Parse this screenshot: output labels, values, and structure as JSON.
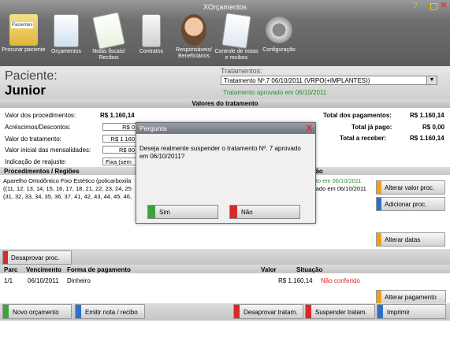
{
  "app": {
    "title": "XOrçamentos"
  },
  "toolbar": {
    "items": [
      {
        "label": "Procurar paciente"
      },
      {
        "label": "Orçamentos"
      },
      {
        "label": "Notas fiscais/ Recibos"
      },
      {
        "label": "Contratos"
      },
      {
        "label": "Responsáveis/ Beneficiários"
      },
      {
        "label": "Controle de notas e recibos"
      },
      {
        "label": "Configuração"
      }
    ],
    "badge": "Pacientes"
  },
  "patient": {
    "label": "Paciente:",
    "name": "Junior"
  },
  "treatments": {
    "label": "Tratamentos:",
    "selected": "Tratamento Nº.7 06/10/2011 (VRPO(+IMPLANTES))",
    "status": "Tratamento aprovado em 06/10/2011"
  },
  "values": {
    "header": "Valores do tratamento",
    "procedures_label": "Valor dos procedimentos:",
    "procedures_value": "R$ 1.160,14",
    "additions_label": "Acréscimos/Descontos:",
    "additions_value": "R$ 0",
    "treatment_label": "Valor do tratamento:",
    "treatment_value": "R$ 1.160",
    "initial_label": "Valor inicial das mensalidades:",
    "initial_value": "R$ 80",
    "readjust_label": "Indicação de reajuste:",
    "readjust_value": "Fixa (sem a",
    "total_payments_label": "Total dos pagamentos:",
    "total_payments_value": "R$ 1.160,14",
    "total_paid_label": "Total já pago:",
    "total_paid_value": "R$ 0,00",
    "total_receive_label": "Total a receber:",
    "total_receive_value": "R$ 1.160,14"
  },
  "procedures": {
    "header": "Procedimentos / Regiões",
    "status_header": "ção",
    "line1": "Aparelho Ortodôntico Fixo Estético (policarboxila",
    "line2": "((11, 12, 13, 14, 15, 16, 17, 18, 21, 22, 23, 24, 25",
    "line3": "(31, 32, 33, 34, 35, 36, 37, 41, 42, 43, 44, 45, 46,",
    "status1": "sto em 06/10/2011",
    "status2": "vado em 06/10/2011"
  },
  "buttons": {
    "alter_value": "Alterar valor proc.",
    "add_proc": "Adicionar proc.",
    "alter_dates": "Alterar datas",
    "disapprove_proc": "Desaprovar proc.",
    "alter_payment": "Alterar pagamento",
    "new_budget": "Novo orçamento",
    "emit_note": "Emitir nota / recibo",
    "disapprove_treat": "Desaprovar tratam.",
    "suspend_treat": "Suspender tratam.",
    "print": "Imprimir"
  },
  "payments": {
    "headers": {
      "parc": "Parc",
      "due": "Vencimento",
      "form": "Forma de pagamento",
      "value": "Valor",
      "status": "Situação"
    },
    "rows": [
      {
        "parc": "1/1",
        "due": "06/10/2011",
        "form": "Dinheiro",
        "value": "R$ 1.160,14",
        "status": "Não conferido"
      }
    ]
  },
  "dialog": {
    "title": "Pergunta",
    "message": "Deseja realmente suspender o tratamento Nº. 7 aprovado em 06/10/2011?",
    "yes": "Sim",
    "no": "Não"
  },
  "colors": {
    "accent_green": "#2a8a2a",
    "danger": "#d72a2a",
    "status_red": "#e02020"
  }
}
